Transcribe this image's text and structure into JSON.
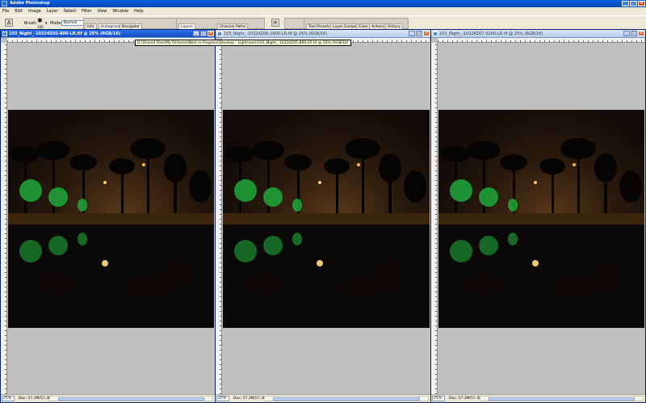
{
  "app": {
    "title": "Adobe Photoshop"
  },
  "menu": [
    "File",
    "Edit",
    "Image",
    "Layer",
    "Select",
    "Filter",
    "View",
    "Window",
    "Help"
  ],
  "options": {
    "brush_label": "Brush:",
    "brush_size": "100",
    "mode_label": "Mode:",
    "mode_value": "Normal"
  },
  "palette_well": {
    "left_tabs": [
      "Info",
      "Histogram",
      "Navigator"
    ],
    "mid_tabs": [
      "Layers",
      "Channels",
      "Paths"
    ],
    "right_tabs": [
      "Tool Presets",
      "Layer Comps",
      "Color",
      "Actions",
      "History"
    ]
  },
  "documents": [
    {
      "title": "103_Night_-10324Z05-800-LR.tif @ 25% (RGB/16)",
      "zoom": "25%",
      "doc_size": "Doc: 57.3M/57.3M",
      "active": true
    },
    {
      "title": "103_Night_-10324Z06-1600-LR.tif @ 25% (RGB/16)",
      "zoom": "25%",
      "doc_size": "Doc: 57.3M/57.3M",
      "active": false
    },
    {
      "title": "103_Night_-10324Z07-3200-LR.tif @ 25% (RGB/16)",
      "zoom": "25%",
      "doc_size": "Doc: 57.3M/57.3M",
      "active": false
    }
  ],
  "tooltip": "D:\\Shared Files\\My Pictures\\Work In Progress\\Develop - Lightroom\\103_Night_-10324Z05-800-LR.tif @ 25% (RGB/16)",
  "colors": {
    "xp_title": "#0845b8",
    "chrome": "#ece9d8",
    "canvas_bg": "#c0c0c0",
    "workspace": "#848284"
  }
}
